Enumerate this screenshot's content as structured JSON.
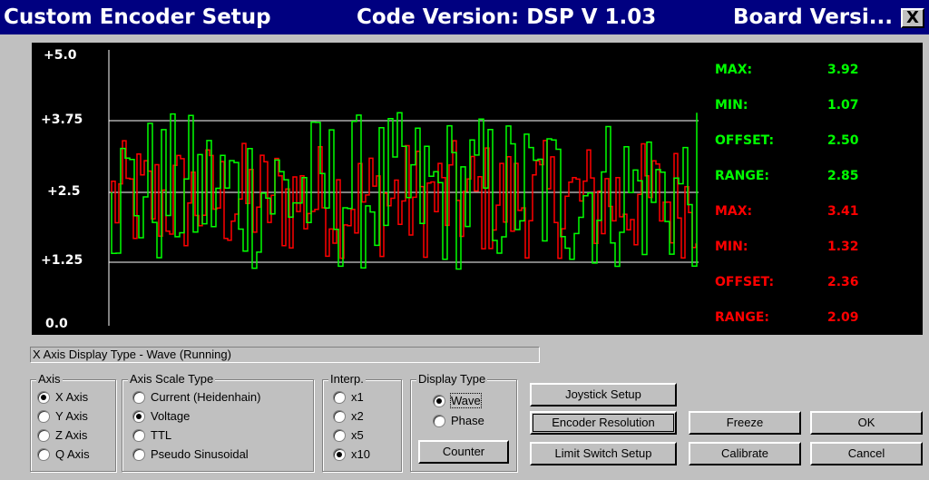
{
  "window": {
    "title": "Custom Encoder Setup",
    "code_version": "Code Version: DSP V 1.03",
    "board_version": "Board Versi...",
    "close_label": "X"
  },
  "scope": {
    "y_ticks": [
      "+5.0",
      "+3.75",
      "+2.5",
      "+1.25",
      "0.0"
    ],
    "green_stats": [
      {
        "label": "MAX:",
        "value": "3.92"
      },
      {
        "label": "MIN:",
        "value": "1.07"
      },
      {
        "label": "OFFSET:",
        "value": "2.50"
      },
      {
        "label": "RANGE:",
        "value": "2.85"
      }
    ],
    "red_stats": [
      {
        "label": "MAX:",
        "value": "3.41"
      },
      {
        "label": "MIN:",
        "value": "1.32"
      },
      {
        "label": "OFFSET:",
        "value": "2.36"
      },
      {
        "label": "RANGE:",
        "value": "2.09"
      }
    ],
    "colors": {
      "green": "#00ff00",
      "red": "#ff0000",
      "background": "#000000"
    }
  },
  "status_text": "X Axis   Display Type - Wave (Running)",
  "axis_group": {
    "label": "Axis",
    "options": [
      "X Axis",
      "Y Axis",
      "Z Axis",
      "Q Axis"
    ],
    "selected": "X Axis"
  },
  "scale_group": {
    "label": "Axis Scale Type",
    "options": [
      "Current (Heidenhain)",
      "Voltage",
      "TTL",
      "Pseudo Sinusoidal"
    ],
    "selected": "Voltage"
  },
  "interp_group": {
    "label": "Interp.",
    "options": [
      "x1",
      "x2",
      "x5",
      "x10"
    ],
    "selected": "x10"
  },
  "display_group": {
    "label": "Display Type",
    "options": [
      "Wave",
      "Phase"
    ],
    "selected": "Wave",
    "counter_label": "Counter"
  },
  "buttons": {
    "joystick": "Joystick Setup",
    "encoder_resolution": "Encoder Resolution",
    "limit_switch": "Limit Switch Setup",
    "freeze": "Freeze",
    "calibrate": "Calibrate",
    "ok": "OK",
    "cancel": "Cancel"
  }
}
